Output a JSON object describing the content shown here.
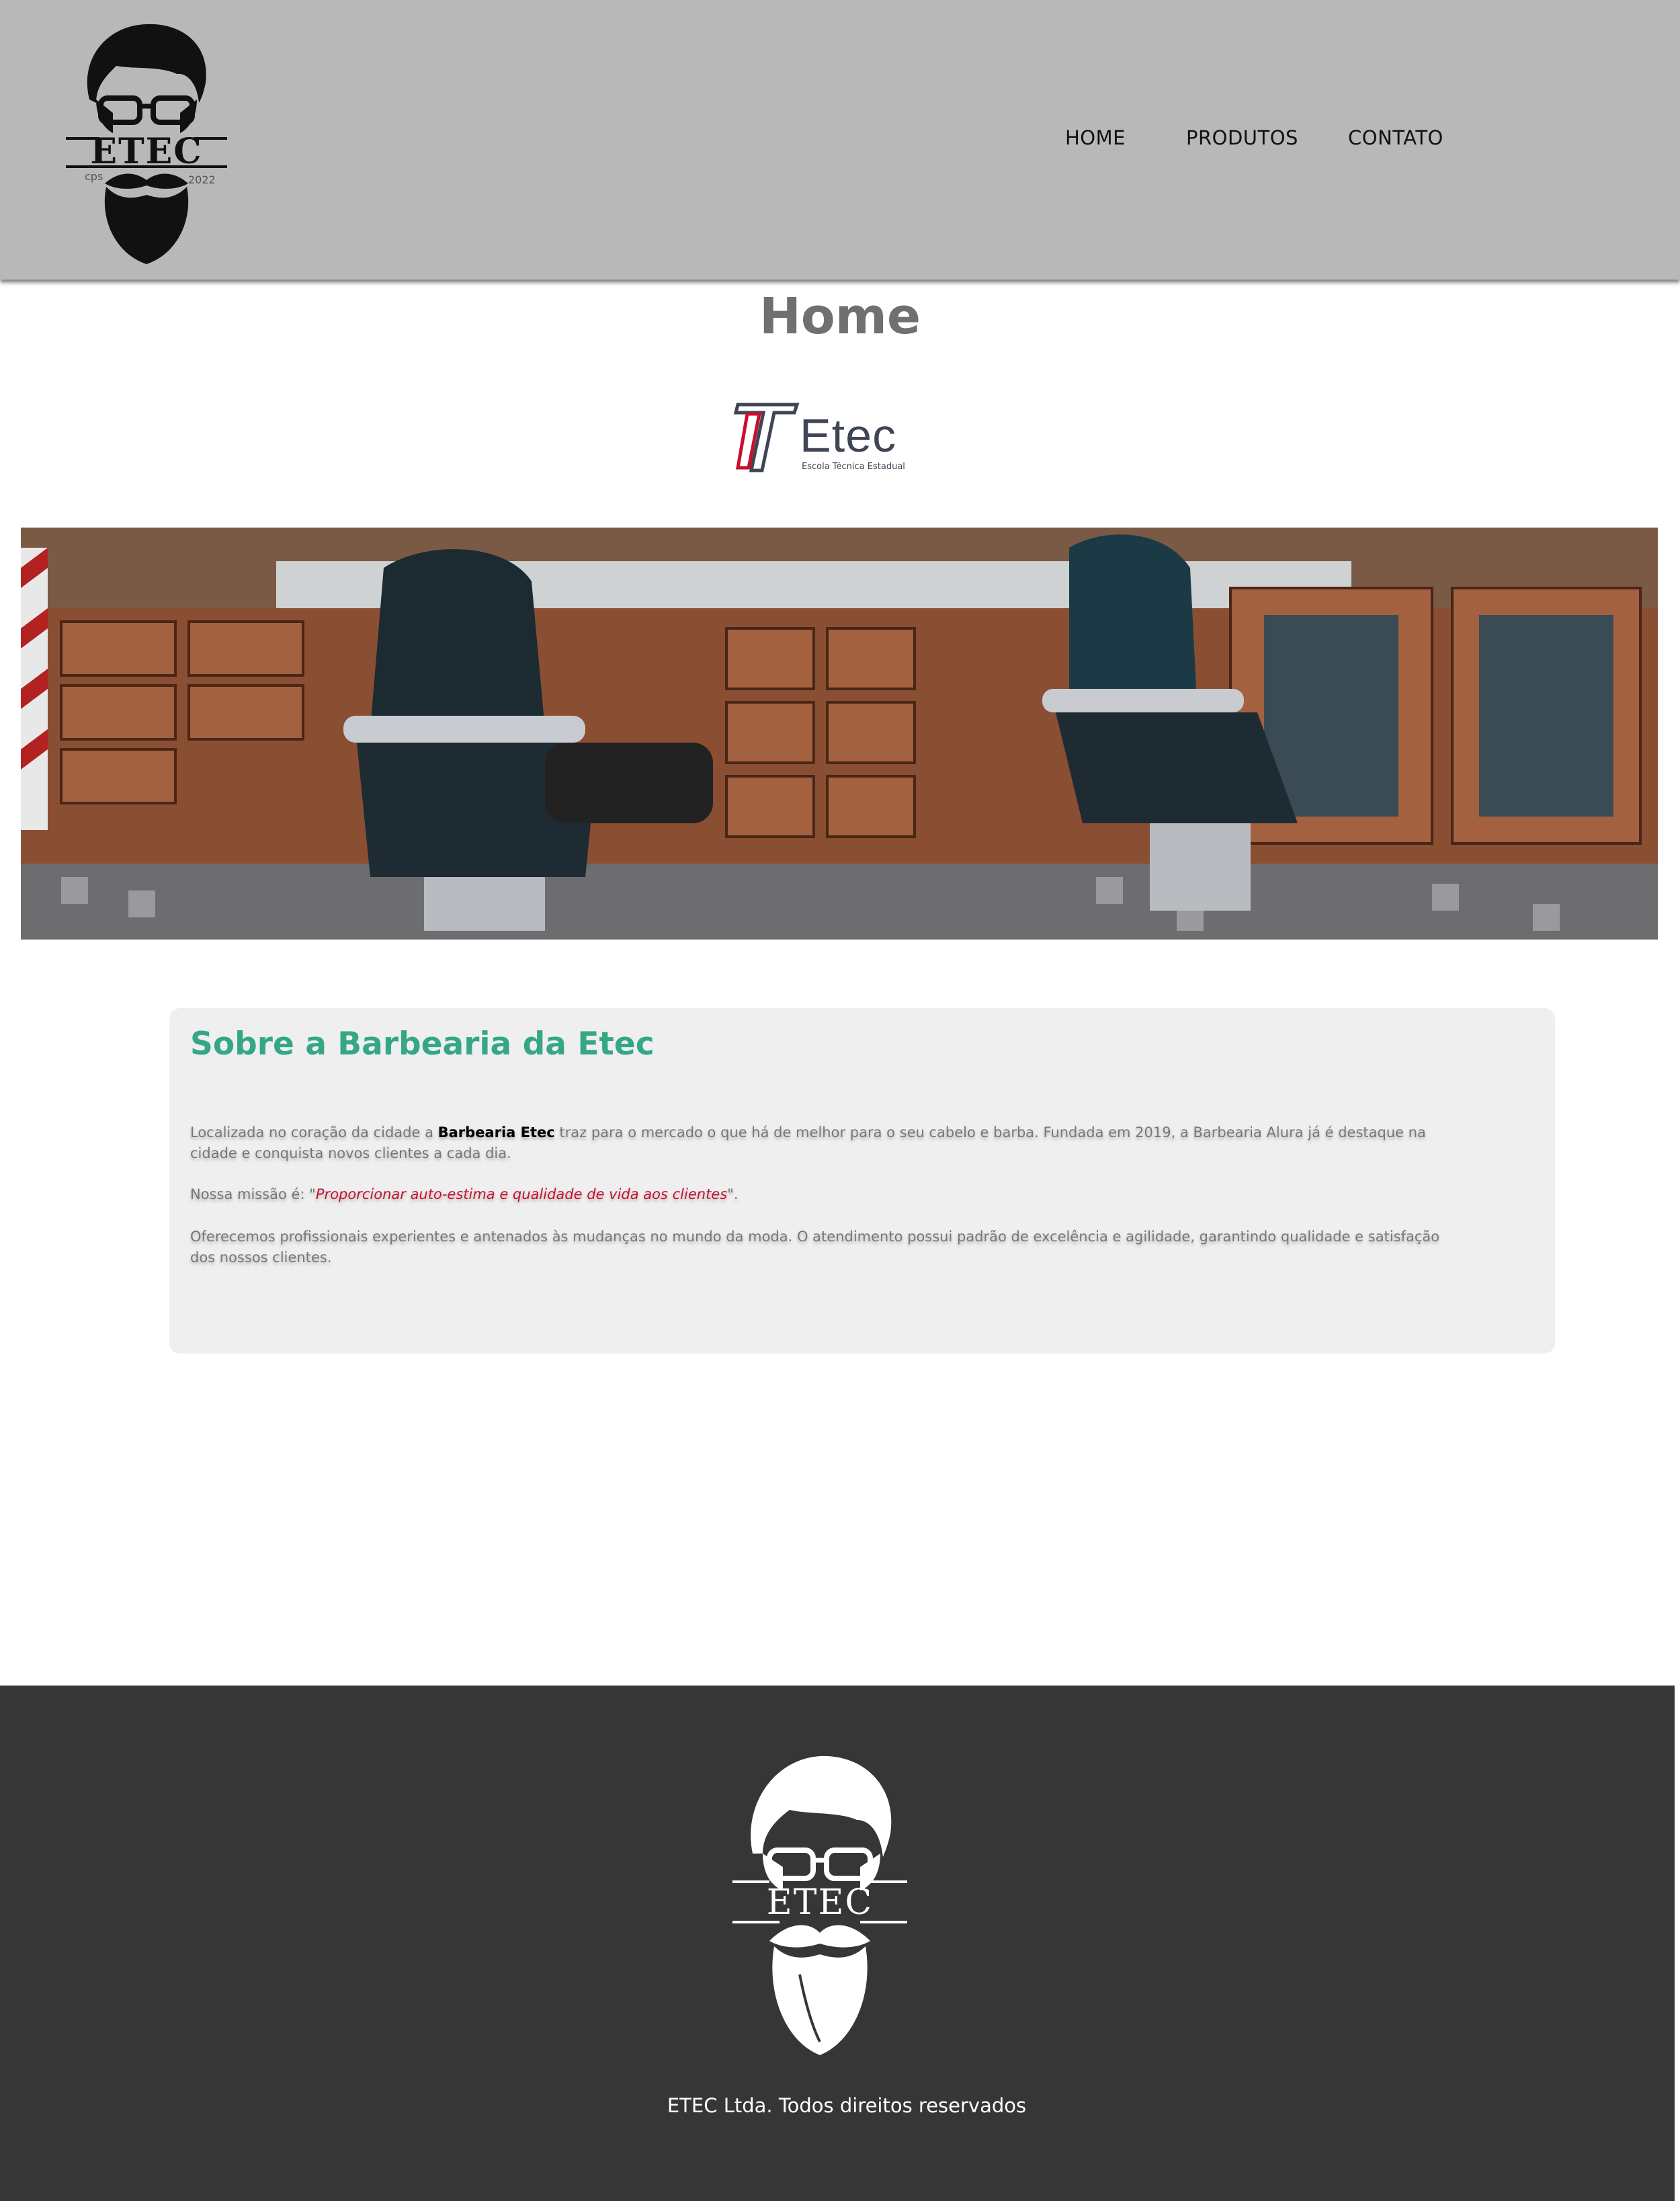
{
  "header": {
    "logo": {
      "text": "ETEC",
      "left_caption": "cps",
      "right_caption": "2022"
    },
    "nav": [
      {
        "label": "HOME"
      },
      {
        "label": "PRODUTOS"
      },
      {
        "label": "CONTATO"
      }
    ]
  },
  "main": {
    "title": "Home",
    "etec_logo": {
      "word": "Etec",
      "subtitle": "Escola Técnica Estadual"
    },
    "about": {
      "heading": "Sobre a Barbearia da Etec",
      "p1_before": "Localizada no coração da cidade a ",
      "p1_bold": "Barbearia Etec",
      "p1_after": " traz para o mercado o que há de melhor para o seu cabelo e barba. Fundada em 2019, a Barbearia Alura já é destaque na cidade e conquista novos clientes a cada dia.",
      "p2_before": "Nossa missão é: \"",
      "p2_mission": "Proporcionar auto-estima e qualidade de vida aos clientes",
      "p2_after": "\".",
      "p3": "Oferecemos profissionais experientes e antenados às mudanças no mundo da moda. O atendimento possui padrão de excelência e agilidade, garantindo qualidade e satisfação dos nossos clientes."
    }
  },
  "footer": {
    "logo_text": "ETEC",
    "copyright": "ETEC Ltda. Todos direitos reservados"
  },
  "colors": {
    "header_bg": "#b8b8b8",
    "accent_green": "#35a787",
    "mission_red": "#c8102e",
    "footer_bg": "#363636"
  }
}
